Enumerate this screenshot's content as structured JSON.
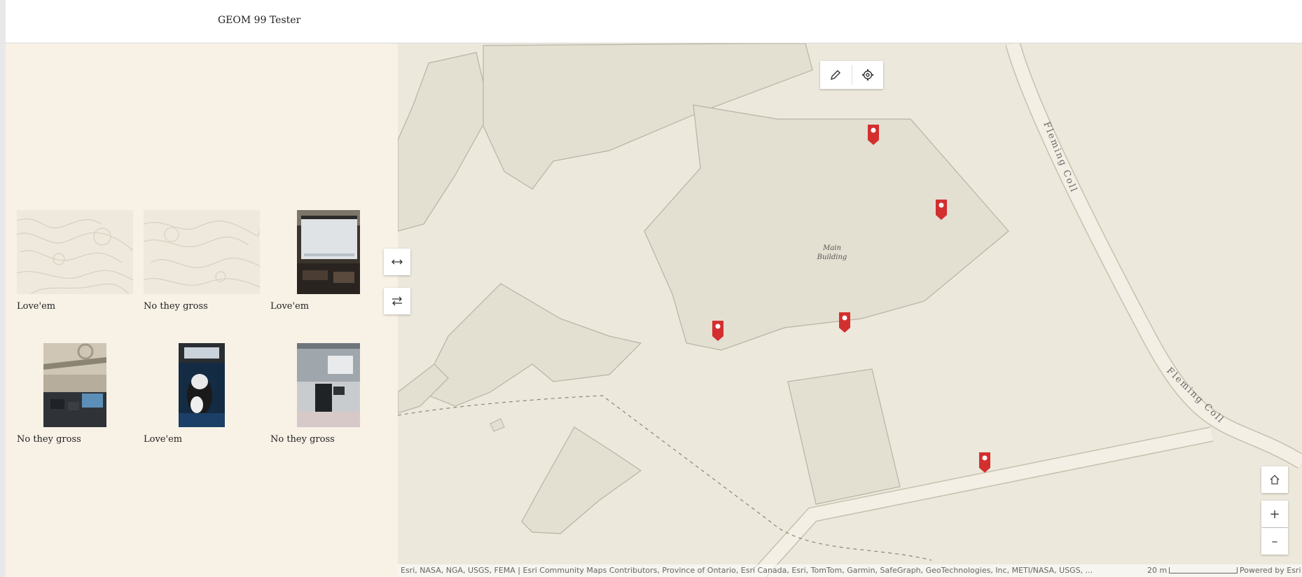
{
  "header": {
    "title": "GEOM 99 Tester"
  },
  "gallery": {
    "items": [
      {
        "caption": "Love'em",
        "image": "topographic-placeholder"
      },
      {
        "caption": "No they gross",
        "image": "topographic-placeholder"
      },
      {
        "caption": "Love'em",
        "image": "projector-screen-photo"
      },
      {
        "caption": "No they gross",
        "image": "classroom-ceiling-photo"
      },
      {
        "caption": "Love'em",
        "image": "cat-in-car-photo"
      },
      {
        "caption": "No they gross",
        "image": "lecture-room-photo"
      }
    ]
  },
  "map": {
    "labels": {
      "building": "Main\nBuilding",
      "road_upper": "Fleming Coll",
      "road_lower": "Fleming Coll"
    },
    "toolbar": {
      "edit_icon": "pencil-icon",
      "settings_icon": "gear-icon"
    },
    "swap_buttons": [
      "horizontal-arrows-icon",
      "swap-arrows-icon"
    ],
    "nav": {
      "home_icon": "home-icon",
      "zoom_in": "+",
      "zoom_out": "–"
    },
    "attribution": "Esri, NASA, NGA, USGS, FEMA | Esri Community Maps Contributors, Province of Ontario, Esri Canada, Esri, TomTom, Garmin, SafeGraph, GeoTechnologies, Inc, METI/NASA, USGS, ...",
    "scale_label": "20 m",
    "powered_by": "Powered by Esri",
    "marker_color": "#d32f2f"
  },
  "colors": {
    "panel_bg": "#f8f1e6",
    "map_bg": "#ece8dc",
    "building_fill": "#e3dfd1",
    "road_fill": "#f3efe4"
  }
}
